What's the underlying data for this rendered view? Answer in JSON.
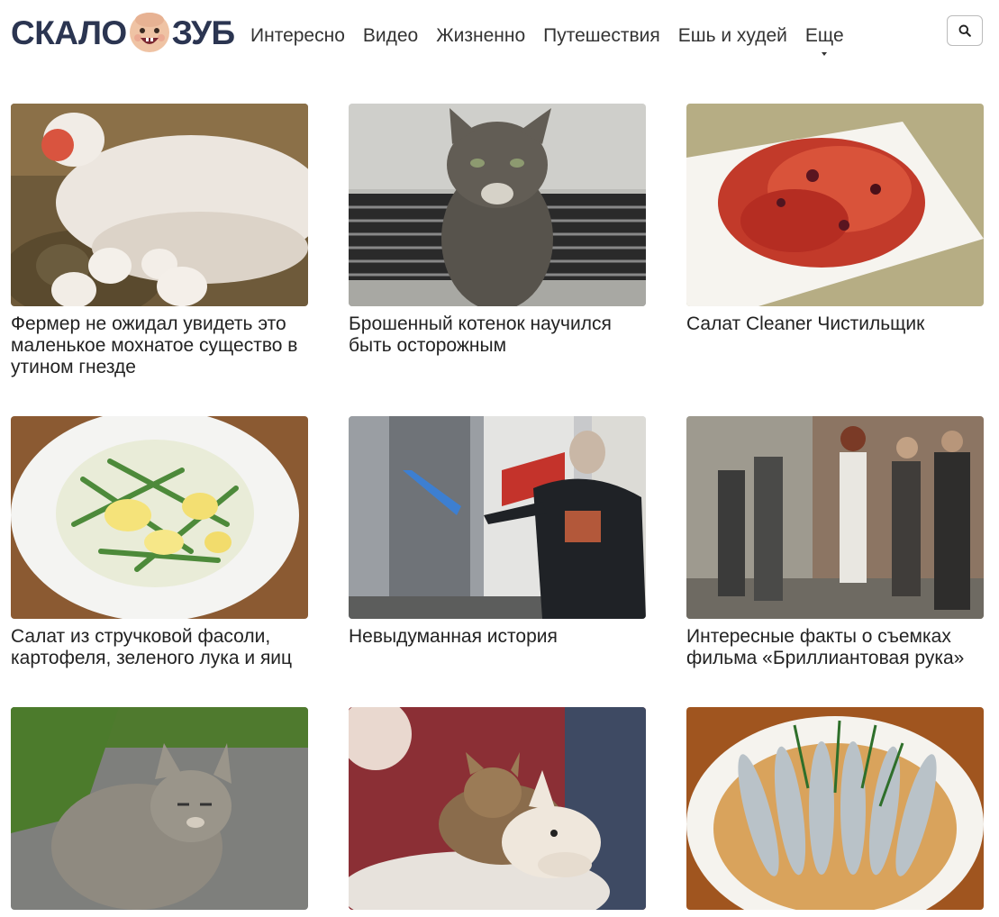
{
  "site": {
    "logo_left": "СКАЛО",
    "logo_right": "ЗУБ"
  },
  "nav": {
    "items": [
      {
        "label": "Интересно"
      },
      {
        "label": "Видео"
      },
      {
        "label": "Жизненно"
      },
      {
        "label": "Путешествия"
      },
      {
        "label": "Ешь и худей"
      },
      {
        "label": "Еще"
      }
    ]
  },
  "search": {
    "icon": "search-icon"
  },
  "cards": [
    {
      "title": "Фермер не ожидал увидеть это маленькое мохнатое существо в утином гнезде",
      "image": "duck-nest-photo"
    },
    {
      "title": "Брошенный котенок научился быть осторожным",
      "image": "cat-on-grate-photo"
    },
    {
      "title": "Салат Cleaner Чистильщик",
      "image": "beet-salad-photo"
    },
    {
      "title": "Салат из стручковой фасоли, картофеля, зеленого лука и яиц",
      "image": "bean-salad-photo"
    },
    {
      "title": "Невыдуманная история",
      "image": "veteran-train-photo"
    },
    {
      "title": "Интересные факты о съемках фильма «Бриллиантовая рука»",
      "image": "film-scene-photo"
    },
    {
      "title": "",
      "image": "tabby-cat-photo"
    },
    {
      "title": "",
      "image": "cat-and-dog-photo"
    },
    {
      "title": "",
      "image": "fish-dish-photo"
    }
  ]
}
